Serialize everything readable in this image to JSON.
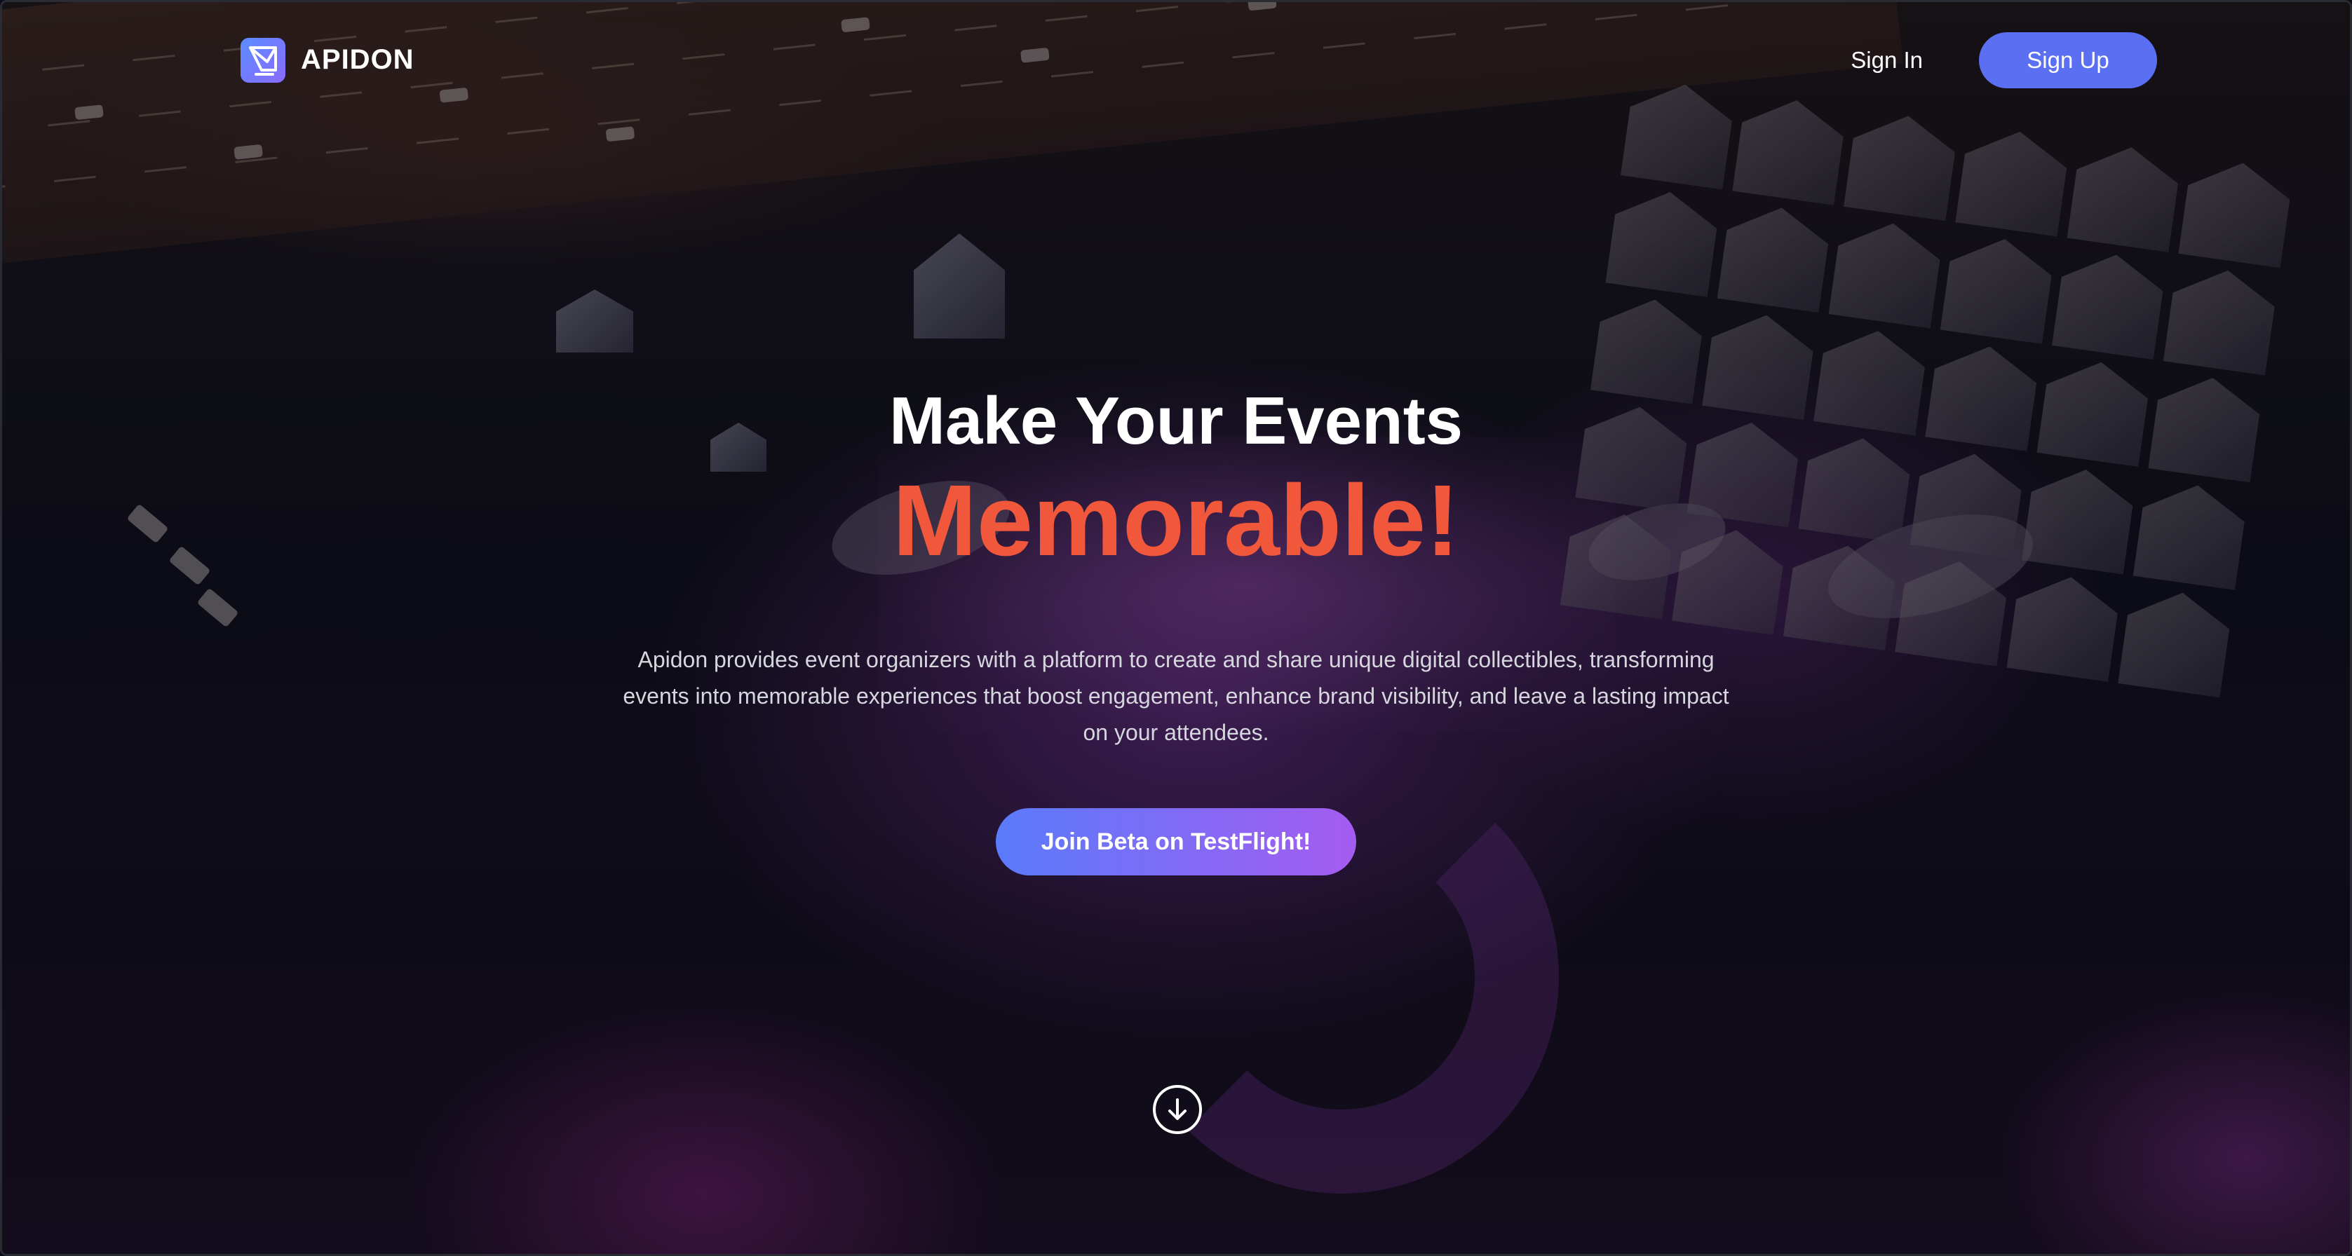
{
  "header": {
    "brand_name": "APIDON",
    "sign_in_label": "Sign In",
    "sign_up_label": "Sign Up"
  },
  "hero": {
    "title_line1": "Make Your Events",
    "title_line2": "Memorable!",
    "description": "Apidon provides event organizers with a platform to create and share unique digital collectibles, transforming events into memorable experiences that boost engagement, enhance brand visibility, and leave a lasting impact on your attendees.",
    "cta_label": "Join Beta on TestFlight!"
  },
  "icons": {
    "logo": "apidon-logo-icon",
    "scroll": "arrow-down-circle-icon"
  },
  "colors": {
    "accent_orange": "#f1573a",
    "sign_up_bg": "#5a6ff2",
    "cta_gradient_start": "#5a7bfb",
    "cta_gradient_end": "#a55cf0"
  }
}
